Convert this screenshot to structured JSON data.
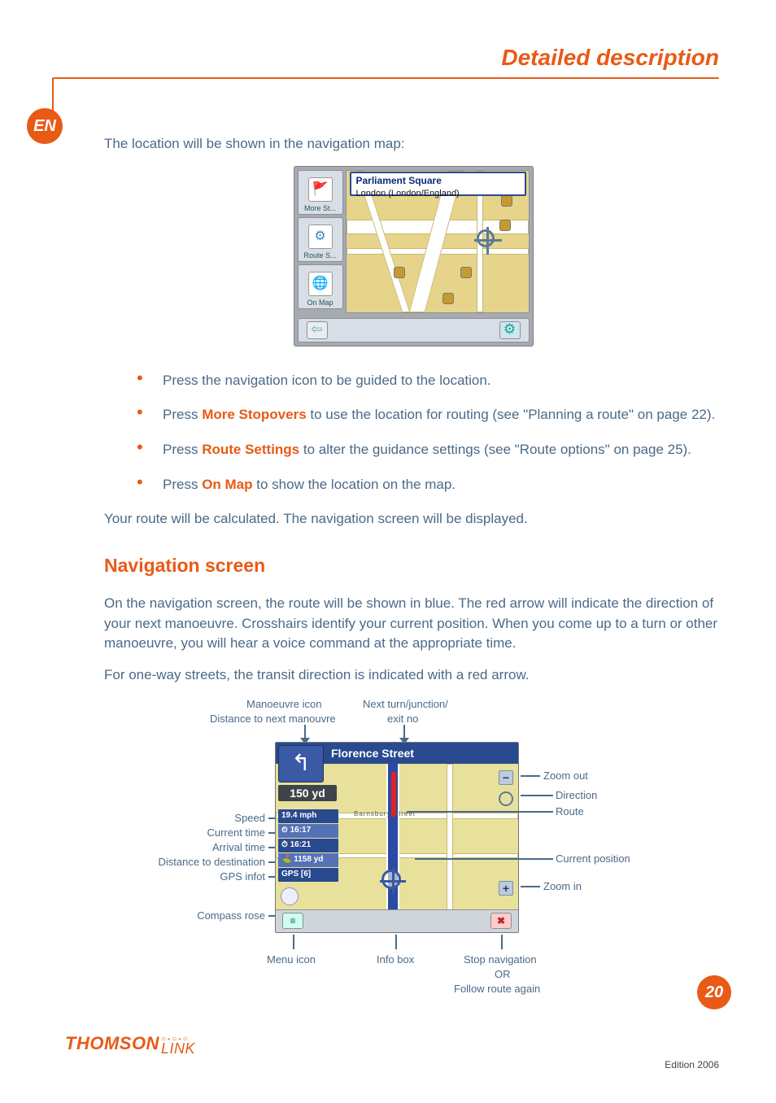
{
  "header": {
    "section_title": "Detailed description"
  },
  "lang_badge": "EN",
  "intro_text": "The location will be shown in the navigation map:",
  "map_shot_1": {
    "left_tiles": [
      {
        "label": "More St..."
      },
      {
        "label": "Route S..."
      },
      {
        "label": "On Map"
      }
    ],
    "address_title": "Parliament Square",
    "address_sub": "London (London/England)",
    "back_glyph": "⇦",
    "opt_glyph": "⚙"
  },
  "bullets": [
    {
      "pre": "Press the navigation icon to be guided to the location.",
      "strong": "",
      "post": ""
    },
    {
      "pre": "Press ",
      "strong": "More Stopovers",
      "post": " to use the location for routing (see \"Planning a route\" on page 22)."
    },
    {
      "pre": "Press ",
      "strong": "Route Settings",
      "post": " to alter the guidance settings (see \"Route options\" on page 25)."
    },
    {
      "pre": "Press ",
      "strong": "On Map",
      "post": " to show the location on the map."
    }
  ],
  "after_bullets": "Your route will be calculated. The navigation screen will be displayed.",
  "subheading": "Navigation screen",
  "para1": "On the navigation screen, the route will be shown in blue. The red arrow will indicate the direction of your next manoeuvre. Crosshairs identify your current position. When you come up to a turn or other manoeuvre, you will hear a voice command at the appropriate time.",
  "para2": "For one-way streets, the transit direction is indicated with a red arrow.",
  "nav_shot": {
    "top_street": "Florence Street",
    "manoeuvre_glyph": "↰",
    "distance_next": "150 yd",
    "sec_street": "Barnsbury  Street",
    "side_rows": {
      "speed": "19.4 mph",
      "current_time": "⏲ 16:17",
      "arrival_time": "⏱ 16:21",
      "dist_dest": "⛳ 1158 yd",
      "gps": "GPS [6]"
    },
    "zoom_out_glyph": "−",
    "zoom_in_glyph": "+",
    "menu_glyph": "≡",
    "stop_glyph": "✖"
  },
  "callouts": {
    "top_left_1": "Manoeuvre icon",
    "top_left_2": "Distance to next manouvre",
    "top_right_1": "Next turn/junction/",
    "top_right_2": "exit no",
    "left": {
      "speed": "Speed",
      "current_time": "Current time",
      "arrival_time": "Arrival time",
      "dist_dest": "Distance to destination",
      "gps": "GPS infot",
      "compass": "Compass rose"
    },
    "right": {
      "zoom_out": "Zoom out",
      "direction": "Direction",
      "route": "Route",
      "cur_pos": "Current position",
      "zoom_in": "Zoom in"
    },
    "bottom": {
      "menu": "Menu icon",
      "info": "Info box",
      "stop1": "Stop navigation",
      "stop2": "OR",
      "stop3": "Follow route again"
    }
  },
  "footer": {
    "brand_main": "THOMSON",
    "brand_sub": "LINK",
    "page_number": "20",
    "edition": "Edition 2006"
  }
}
